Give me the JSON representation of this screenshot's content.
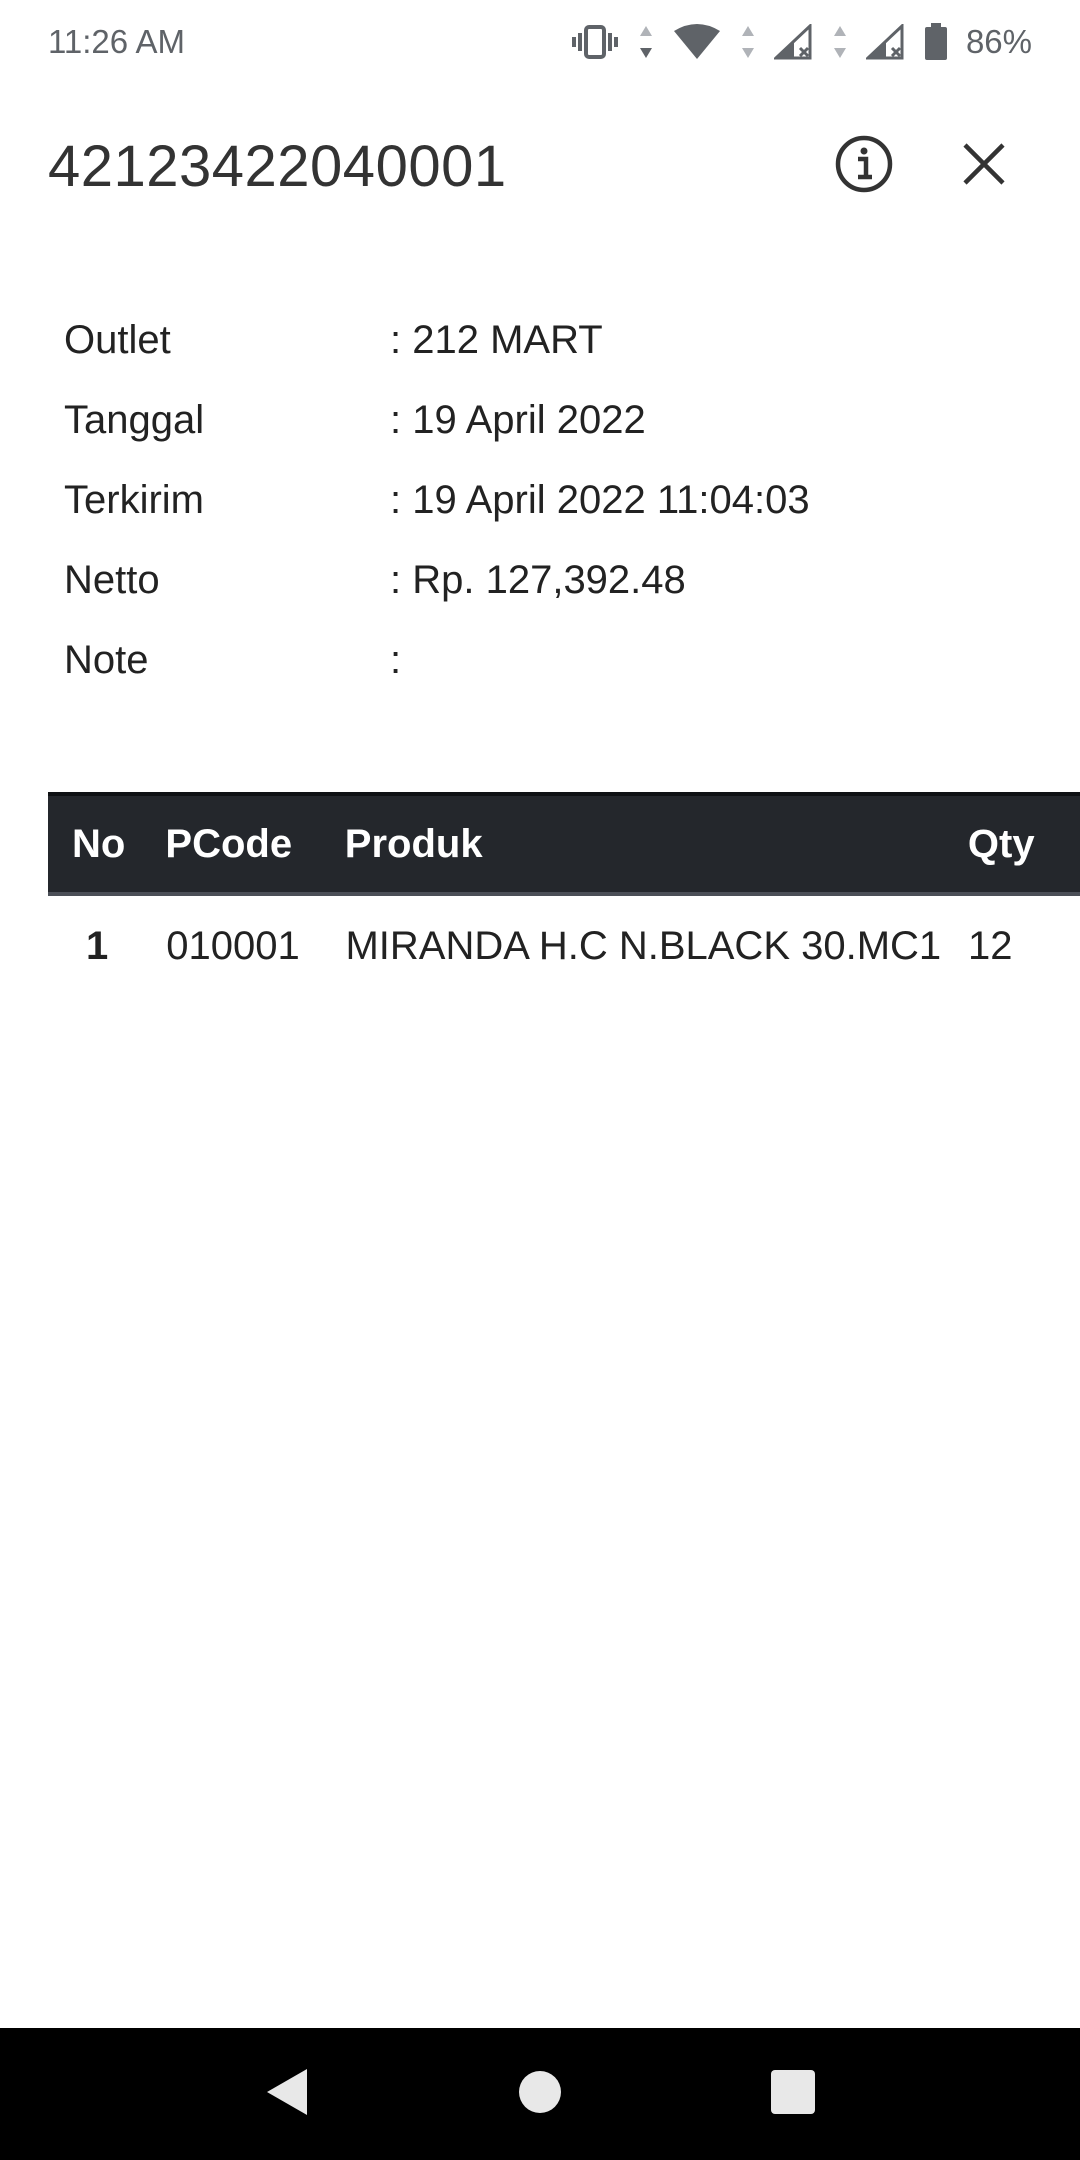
{
  "status_bar": {
    "time": "11:26 AM",
    "battery": "86%",
    "icons": [
      "vibrate-icon",
      "data-arrows-icon",
      "wifi-icon",
      "signal-1-icon",
      "signal-2-icon",
      "battery-icon"
    ]
  },
  "header": {
    "title": "42123422040001",
    "info_icon": "info-icon",
    "close_icon": "close-icon"
  },
  "details": [
    {
      "label": "Outlet",
      "value": ": 212 MART"
    },
    {
      "label": "Tanggal",
      "value": ": 19 April 2022"
    },
    {
      "label": "Terkirim",
      "value": ": 19 April 2022 11:04:03"
    },
    {
      "label": "Netto",
      "value": ": Rp. 127,392.48"
    },
    {
      "label": "Note",
      "value": ":"
    }
  ],
  "table": {
    "headers": {
      "no": "No",
      "pcode": "PCode",
      "produk": "Produk",
      "qty": "Qty"
    },
    "rows": [
      {
        "no": "1",
        "pcode": "010001",
        "produk": "MIRANDA H.C N.BLACK 30.MC1",
        "qty": "12"
      }
    ]
  },
  "nav_bar": {
    "icons": [
      "back-icon",
      "home-icon",
      "recents-icon"
    ]
  },
  "colors": {
    "table_header_bg": "#24272c",
    "nav_bar_bg": "#000000",
    "status_text": "#5f6368"
  }
}
